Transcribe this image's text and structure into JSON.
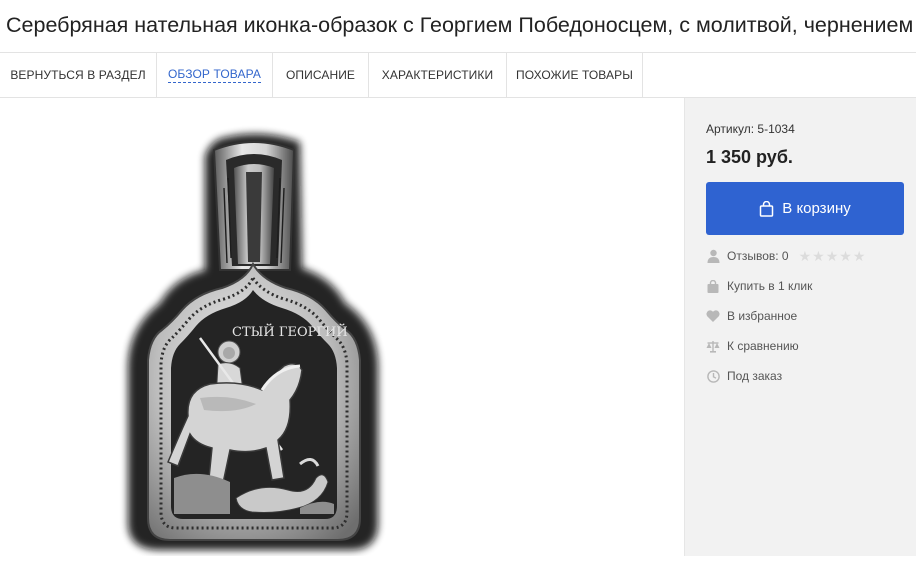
{
  "page": {
    "title": "Серебряная нательная иконка-образок с Георгием Победоносцем, с молитвой, чернением"
  },
  "tabs": [
    {
      "label": "ВЕРНУТЬСЯ В РАЗДЕЛ",
      "active": false
    },
    {
      "label": "ОБЗОР ТОВАРА",
      "active": true
    },
    {
      "label": "ОПИСАНИЕ",
      "active": false
    },
    {
      "label": "ХАРАКТЕРИСТИКИ",
      "active": false
    },
    {
      "label": "ПОХОЖИЕ ТОВАРЫ",
      "active": false
    }
  ],
  "product": {
    "sku": "Артикул: 5-1034",
    "price": "1 350 руб.",
    "cart_button": "В корзину",
    "icon_inscription": "СТЫЙ ГЕОРГИЙ",
    "reviews_label": "Отзывов: 0",
    "rating": 0,
    "rating_max": 5,
    "one_click": "Купить в 1 клик",
    "favorites": "В избранное",
    "compare": "К сравнению",
    "preorder": "Под заказ"
  },
  "colors": {
    "accent": "#2f63d1",
    "active_tab": "#3366cc",
    "sidebar_bg": "#f2f2f2"
  }
}
